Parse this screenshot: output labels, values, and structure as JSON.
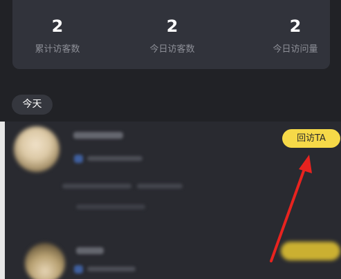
{
  "stats": [
    {
      "value": "2",
      "label": "累计访客数"
    },
    {
      "value": "2",
      "label": "今日访客数"
    },
    {
      "value": "2",
      "label": "今日访问量"
    }
  ],
  "section": {
    "label": "今天"
  },
  "visitors": [
    {
      "action_label": "回访TA"
    }
  ],
  "colors": {
    "accent": "#f6d948",
    "background": "#212226",
    "card": "#31333b",
    "annotation_arrow": "#e8231f"
  },
  "icons": {
    "annotation": "red-arrow-icon"
  }
}
